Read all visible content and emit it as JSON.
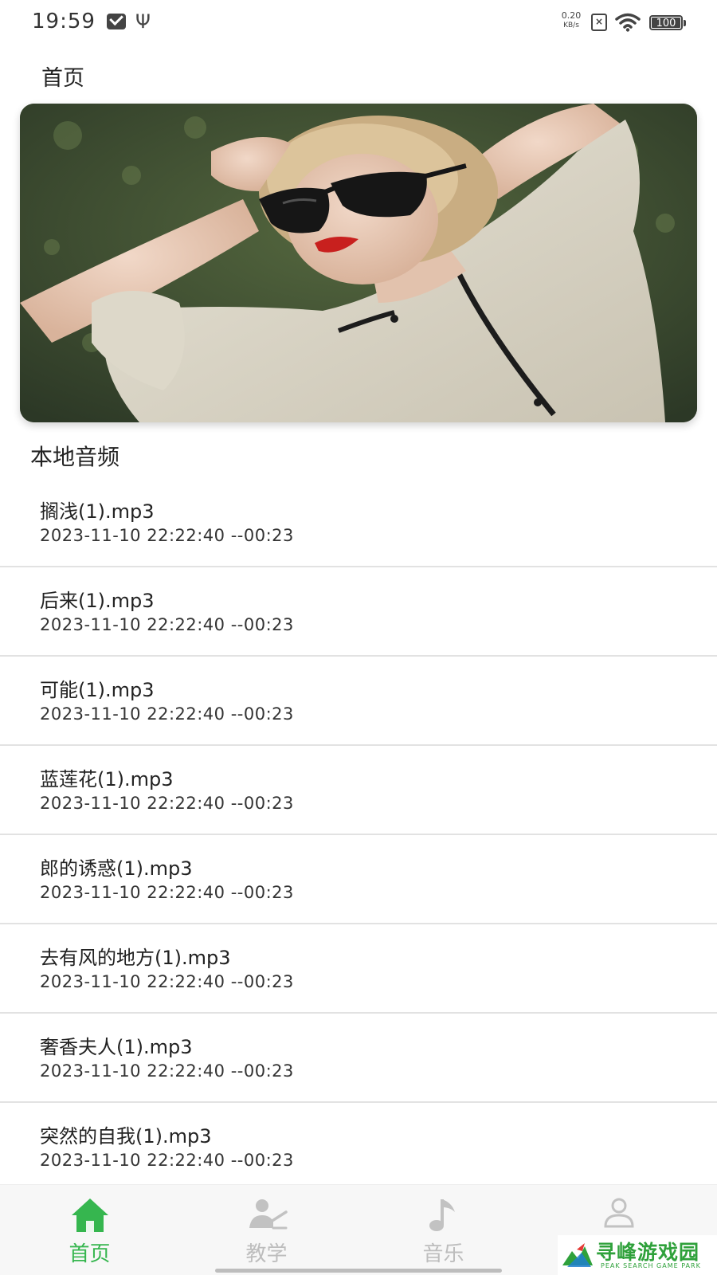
{
  "status_bar": {
    "time": "19:59",
    "icons": [
      "mail-icon",
      "usb-icon",
      "sim-icon",
      "wifi-icon",
      "battery-icon"
    ],
    "speed_value": "0.20",
    "speed_unit": "KB/s",
    "sim_mark": "×",
    "battery": "100"
  },
  "header": {
    "title": "首页"
  },
  "banner": {
    "image": "portrait photo of a woman with sunglasses lying on grass"
  },
  "section": {
    "title": "本地音频"
  },
  "audio_list": [
    {
      "name": "搁浅(1).mp3",
      "meta": "2023-11-10 22:22:40  --00:23"
    },
    {
      "name": "后来(1).mp3",
      "meta": "2023-11-10 22:22:40  --00:23"
    },
    {
      "name": "可能(1).mp3",
      "meta": "2023-11-10 22:22:40  --00:23"
    },
    {
      "name": "蓝莲花(1).mp3",
      "meta": "2023-11-10 22:22:40  --00:23"
    },
    {
      "name": "郎的诱惑(1).mp3",
      "meta": "2023-11-10 22:22:40  --00:23"
    },
    {
      "name": "去有风的地方(1).mp3",
      "meta": "2023-11-10 22:22:40  --00:23"
    },
    {
      "name": "奢香夫人(1).mp3",
      "meta": "2023-11-10 22:22:40  --00:23"
    },
    {
      "name": "突然的自我(1).mp3",
      "meta": "2023-11-10 22:22:40  --00:23"
    }
  ],
  "bottom_nav": {
    "items": [
      {
        "label": "首页",
        "icon": "home-icon",
        "active": true
      },
      {
        "label": "教学",
        "icon": "teacher-icon",
        "active": false
      },
      {
        "label": "音乐",
        "icon": "music-note-icon",
        "active": false
      },
      {
        "label": "",
        "icon": "user-icon",
        "active": false
      }
    ]
  },
  "watermark": {
    "text": "寻峰游戏园",
    "sub": "PEAK SEARCH GAME PARK"
  },
  "colors": {
    "accent": "#36b64f",
    "inactive": "#bdbdbd",
    "divider": "#e2e2e2"
  }
}
